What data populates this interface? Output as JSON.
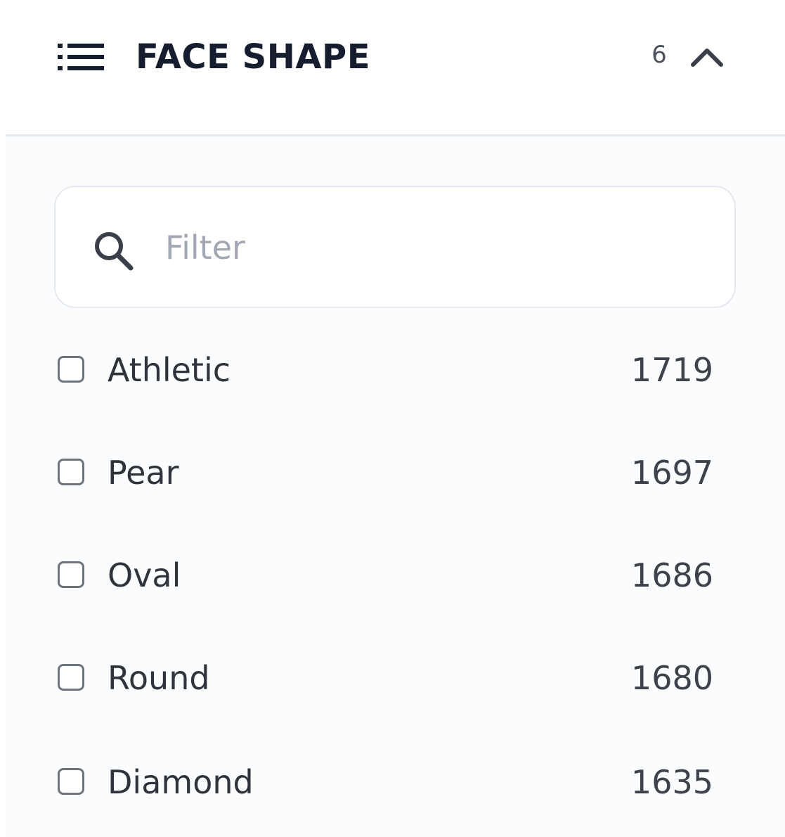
{
  "header": {
    "title": "FACE SHAPE",
    "count": "6",
    "icons": {
      "list": "list-icon",
      "collapse": "chevron-up-icon"
    }
  },
  "filter": {
    "placeholder": "Filter",
    "value": "",
    "icon": "search-icon"
  },
  "options": [
    {
      "label": "Athletic",
      "count": "1719",
      "checked": false
    },
    {
      "label": "Pear",
      "count": "1697",
      "checked": false
    },
    {
      "label": "Oval",
      "count": "1686",
      "checked": false
    },
    {
      "label": "Round",
      "count": "1680",
      "checked": false
    },
    {
      "label": "Diamond",
      "count": "1635",
      "checked": false
    }
  ],
  "colors": {
    "title": "#161d2f",
    "panel_bg": "#fbfcfe",
    "divider": "#e6e9ee",
    "placeholder": "#a2a7b3"
  }
}
